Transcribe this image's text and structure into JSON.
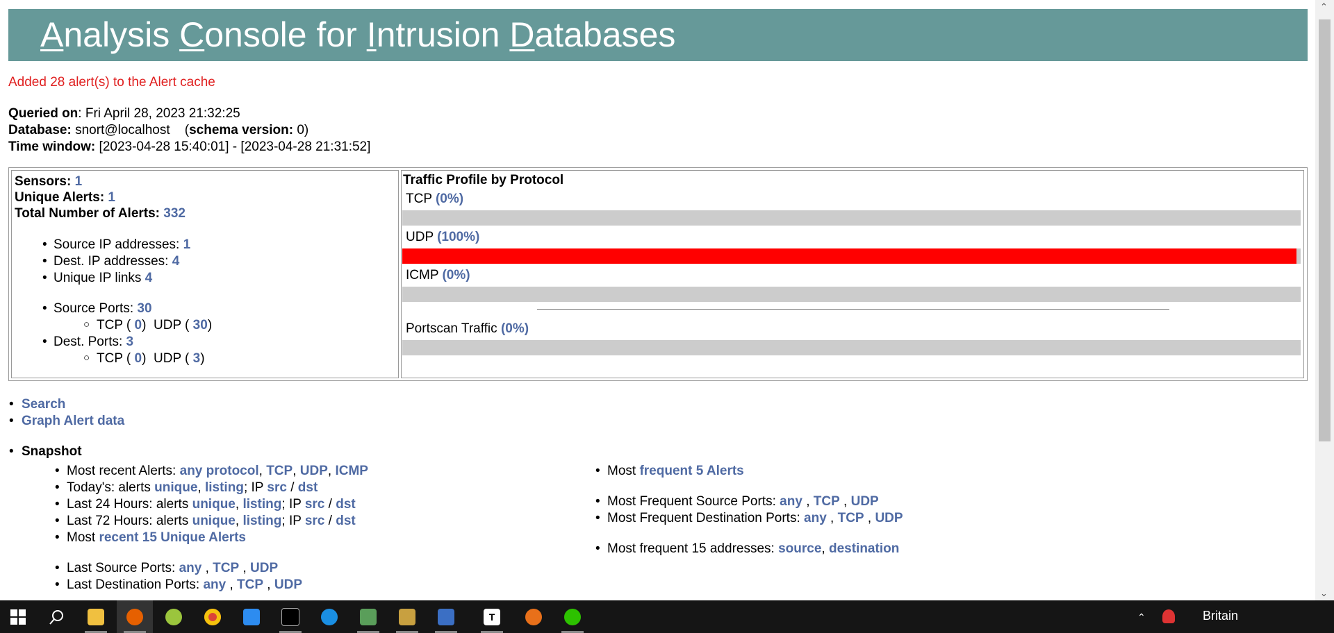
{
  "header": {
    "title_parts": [
      {
        "u": "A",
        "rest": "nalysis "
      },
      {
        "u": "C",
        "rest": "onsole for "
      },
      {
        "u": "I",
        "rest": "ntrusion "
      },
      {
        "u": "D",
        "rest": "atabases"
      }
    ]
  },
  "message": "Added 28 alert(s) to the Alert cache",
  "query": {
    "queried_label": "Queried on",
    "queried_value": ": Fri April 28, 2023 21:32:25",
    "db_label": "Database:",
    "db_value": " snort@localhost    (",
    "schema_label": "schema version:",
    "schema_value": " 0)",
    "window_label": "Time window:",
    "window_value": " [2023-04-28 15:40:01] - [2023-04-28 21:31:52]"
  },
  "stats": {
    "sensors_label": "Sensors:",
    "sensors": "1",
    "unique_label": "Unique Alerts:",
    "unique": "1",
    "total_label": "Total Number of Alerts:",
    "total": "332",
    "src_ip_label": "Source IP addresses:",
    "src_ip": "1",
    "dst_ip_label": "Dest. IP addresses:",
    "dst_ip": "4",
    "ip_links_label": "Unique IP links",
    "ip_links": "4",
    "src_ports_label": "Source Ports:",
    "src_ports": "30",
    "src_tcp": "0",
    "src_udp": "30",
    "dst_ports_label": "Dest. Ports:",
    "dst_ports": "3",
    "dst_tcp": "0",
    "dst_udp": "3",
    "tcp_label": "TCP (",
    "udp_label": ")  UDP (",
    "close": ")"
  },
  "traffic": {
    "title": "Traffic Profile by Protocol",
    "rows": [
      {
        "label": "TCP",
        "pct_text": "(0%)",
        "pct": 0
      },
      {
        "label": "UDP",
        "pct_text": "(100%)",
        "pct": 100
      },
      {
        "label": "ICMP",
        "pct_text": "(0%)",
        "pct": 0
      }
    ],
    "portscan": {
      "label": "Portscan Traffic",
      "pct_text": "(0%)",
      "pct": 0
    },
    "fill_color": "#ff0000",
    "track_color": "#cccccc"
  },
  "nav": {
    "search": "Search",
    "graph": "Graph Alert data",
    "snapshot": "Snapshot"
  },
  "snapshot": {
    "recent_label": "Most recent Alerts: ",
    "any_protocol": "any protocol",
    "tcp": "TCP",
    "udp": "UDP",
    "icmp": "ICMP",
    "today_label": "Today's: alerts ",
    "h24_label": "Last 24 Hours: alerts ",
    "h72_label": "Last 72 Hours: alerts ",
    "unique": "unique",
    "listing": "listing",
    "ip_label": "; IP ",
    "src": "src",
    "dst": "dst",
    "most_label": "Most ",
    "recent15": "recent 15 Unique Alerts",
    "last_src_label": "Last Source Ports: ",
    "last_dst_label": "Last Destination Ports: ",
    "any": "any",
    "freq5": "frequent 5 Alerts",
    "freq_src_label": "Most Frequent Source Ports: ",
    "freq_dst_label": "Most Frequent Destination Ports: ",
    "freq15_label": "Most frequent 15 addresses: ",
    "source": "source",
    "destination": "destination"
  },
  "taskbar": {
    "tray_text": "Britain",
    "icons": [
      "windows-start-icon",
      "search-icon",
      "file-explorer-icon",
      "firefox-icon",
      "app-icon",
      "chrome-icon",
      "bird-app-icon",
      "terminal-icon",
      "app-check-icon",
      "network-tool-icon",
      "folder-tool-icon",
      "settings-app-icon",
      "typora-icon",
      "search-tool-icon",
      "wechat-icon"
    ]
  }
}
